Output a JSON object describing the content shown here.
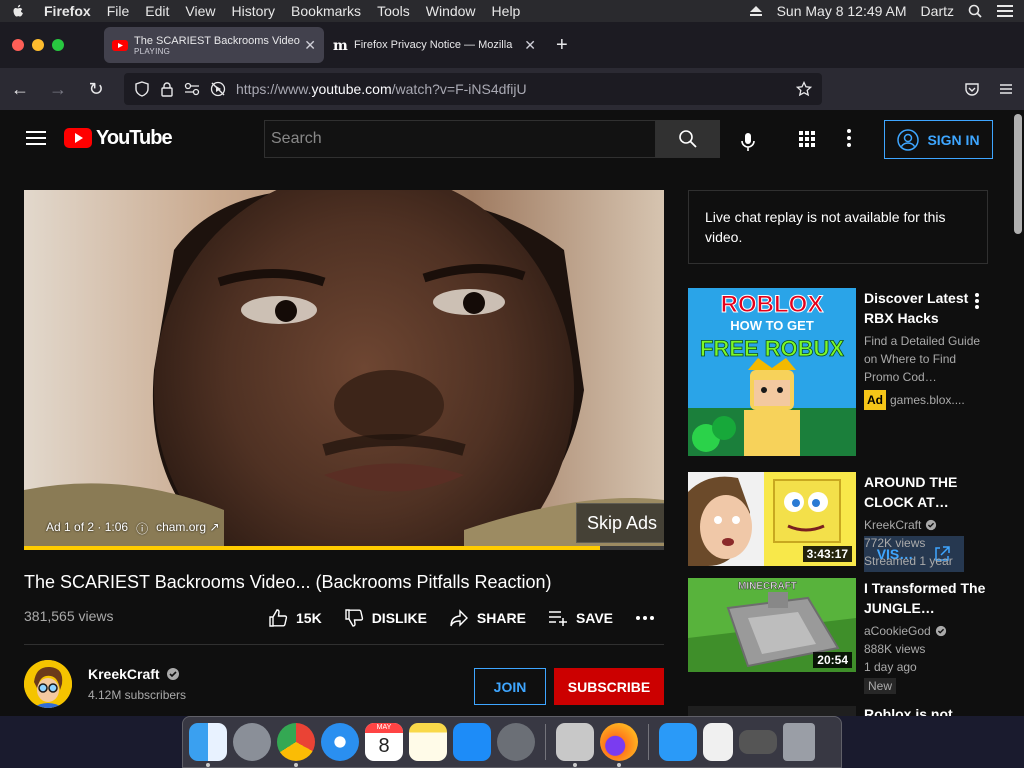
{
  "menubar": {
    "app": "Firefox",
    "items": [
      "File",
      "Edit",
      "View",
      "History",
      "Bookmarks",
      "Tools",
      "Window",
      "Help"
    ],
    "datetime": "Sun May 8  12:49 AM",
    "user": "Dartz"
  },
  "tabs": [
    {
      "title": "The SCARIEST Backrooms Video",
      "sub": "PLAYING"
    },
    {
      "title": "Firefox Privacy Notice — Mozilla"
    }
  ],
  "url": {
    "prefix": "https://www.",
    "host": "youtube.com",
    "path": "/watch?v=F-iNS4dfijU"
  },
  "youtube": {
    "logo": "YouTube",
    "search_placeholder": "Search",
    "signin": "SIGN IN",
    "ad": {
      "label": "Ad 1 of 2 · 1:06",
      "domain": "cham.org",
      "skip": "Skip Ads",
      "progress": 0.9
    },
    "video": {
      "title": "The SCARIEST Backrooms Video... (Backrooms Pitfalls Reaction)",
      "views": "381,565 views",
      "likes": "15K",
      "dislike": "DISLIKE",
      "share": "SHARE",
      "save": "SAVE"
    },
    "channel": {
      "name": "KreekCraft",
      "subs": "4.12M subscribers",
      "join": "JOIN",
      "subscribe": "SUBSCRIBE"
    },
    "live_chat": "Live chat replay is not available for this video.",
    "recs": [
      {
        "title": "Discover Latest RBX Hacks",
        "desc": "Find a Detailed Guide on Where to Find Promo Cod…",
        "ad": "Ad",
        "domain": "games.blox....",
        "visit": "VIS…",
        "thumb_line1": "ROBLOX",
        "thumb_line2": "HOW TO GET",
        "thumb_line3": "FREE ROBUX"
      },
      {
        "title": "AROUND THE CLOCK AT…",
        "channel": "KreekCraft",
        "views": "772K views",
        "age": "Streamed 1 year",
        "duration": "3:43:17"
      },
      {
        "title": "I Transformed The JUNGLE…",
        "channel": "aCookieGod",
        "views": "888K views",
        "age": "1 day ago",
        "badge": "New",
        "duration": "20:54",
        "thumb_text": "MINECRAFT"
      },
      {
        "title": "Roblox is not"
      }
    ]
  },
  "dock": {
    "calendar_month": "MAY",
    "calendar_day": "8"
  },
  "colors": {
    "yt_red": "#ff0000",
    "accent_blue": "#3ea6ff",
    "progress_yellow": "#ffcc00"
  }
}
